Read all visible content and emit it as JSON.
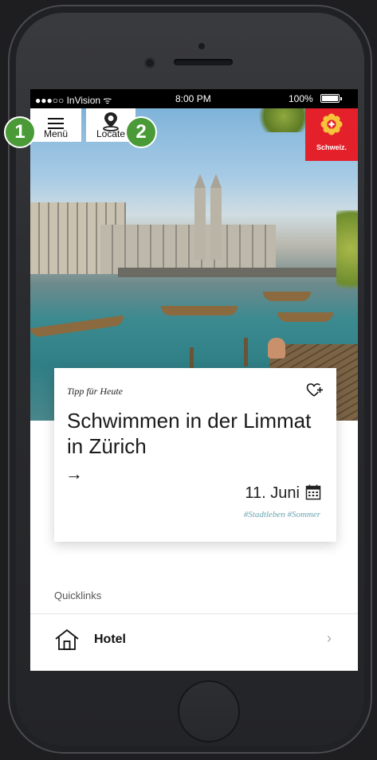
{
  "statusbar": {
    "carrier": "●●●○○ InVision ᯤ",
    "time": "8:00 PM",
    "battery": "100%"
  },
  "nav": {
    "menu_label": "Menü",
    "locate_label": "Locate"
  },
  "brand": {
    "label": "Schweiz."
  },
  "annotations": [
    "1",
    "2"
  ],
  "card": {
    "eyebrow": "Tipp für Heute",
    "title": "Schwimmen in der Limmat in Zürich",
    "arrow": "→",
    "date": "11. Juni",
    "tags": "#Stadtleben #Sommer"
  },
  "quicklinks": {
    "heading": "Quicklinks",
    "items": [
      {
        "label": "Hotel",
        "icon": "home-icon",
        "chevron": "›"
      }
    ]
  },
  "colors": {
    "brand_red": "#e4202b",
    "annotation_green": "#4a9a38",
    "tag_teal": "#6aa5b0"
  }
}
